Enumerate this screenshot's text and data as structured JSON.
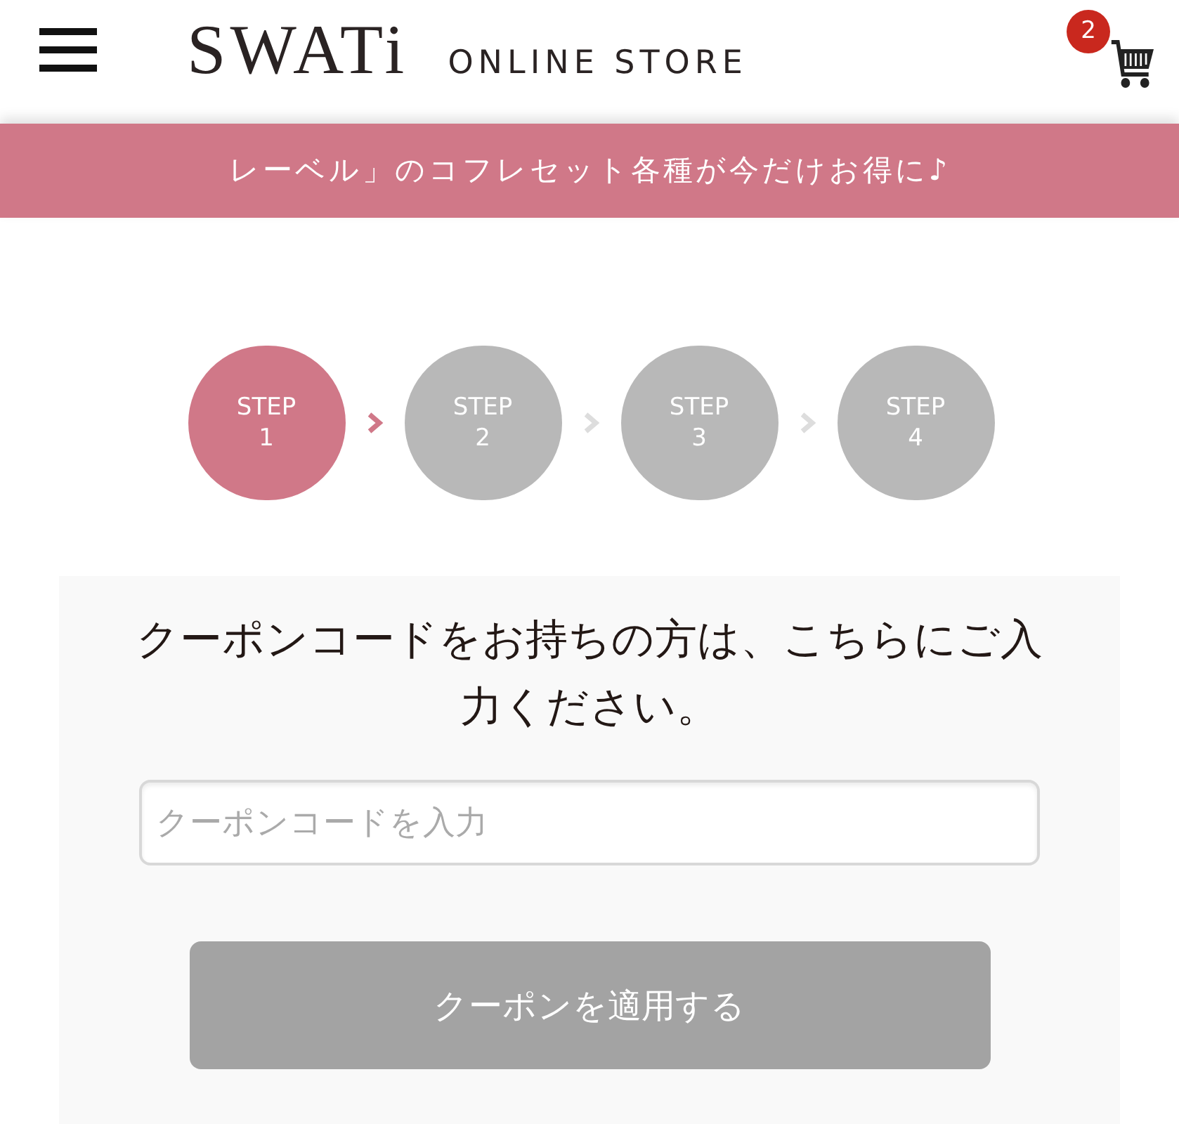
{
  "header": {
    "logo": "SWATi",
    "store_label": "ONLINE STORE",
    "cart_count": "2"
  },
  "banner": {
    "text": "レーベル」のコフレセット各種が今だけお得に♪"
  },
  "steps": [
    {
      "label": "STEP",
      "number": "1",
      "selected": true
    },
    {
      "label": "STEP",
      "number": "2",
      "selected": false
    },
    {
      "label": "STEP",
      "number": "3",
      "selected": false
    },
    {
      "label": "STEP",
      "number": "4",
      "selected": false
    }
  ],
  "coupon": {
    "heading": "クーポンコードをお持ちの方は、こちらにご入力ください。",
    "input": {
      "placeholder": "クーポンコードを入力"
    },
    "button": {
      "label": "クーポンを適用する",
      "disabled": true
    }
  }
}
